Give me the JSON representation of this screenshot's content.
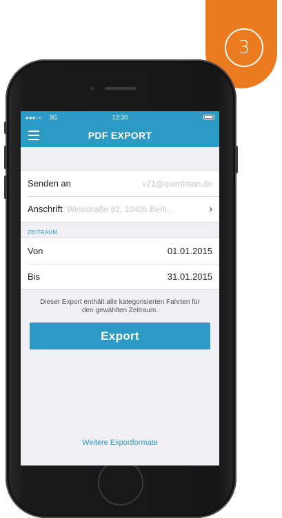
{
  "step_badge": {
    "number": "3",
    "color": "#ec7a1e"
  },
  "statusbar": {
    "signal": "●●●○○",
    "carrier": "3G",
    "time": "12:30"
  },
  "navbar": {
    "title": "PDF EXPORT",
    "menu_icon": "hamburger-menu-icon",
    "color": "#2b9ac4"
  },
  "form": {
    "send_to": {
      "label": "Senden an",
      "placeholder": "v71@quentman.de"
    },
    "address": {
      "label": "Anschrift",
      "value": "Winsstraße 62, 10405 Berli…",
      "chevron": "›"
    },
    "period_header": "ZEITRAUM",
    "from": {
      "label": "Von",
      "value": "01.01.2015"
    },
    "to": {
      "label": "Bis",
      "value": "31.01.2015"
    }
  },
  "info_text": "Dieser Export enthält alle kategorisierten Fahrten für den gewählten Zeitraum.",
  "export_button": "Export",
  "more_formats_link": "Weitere Exportformate"
}
